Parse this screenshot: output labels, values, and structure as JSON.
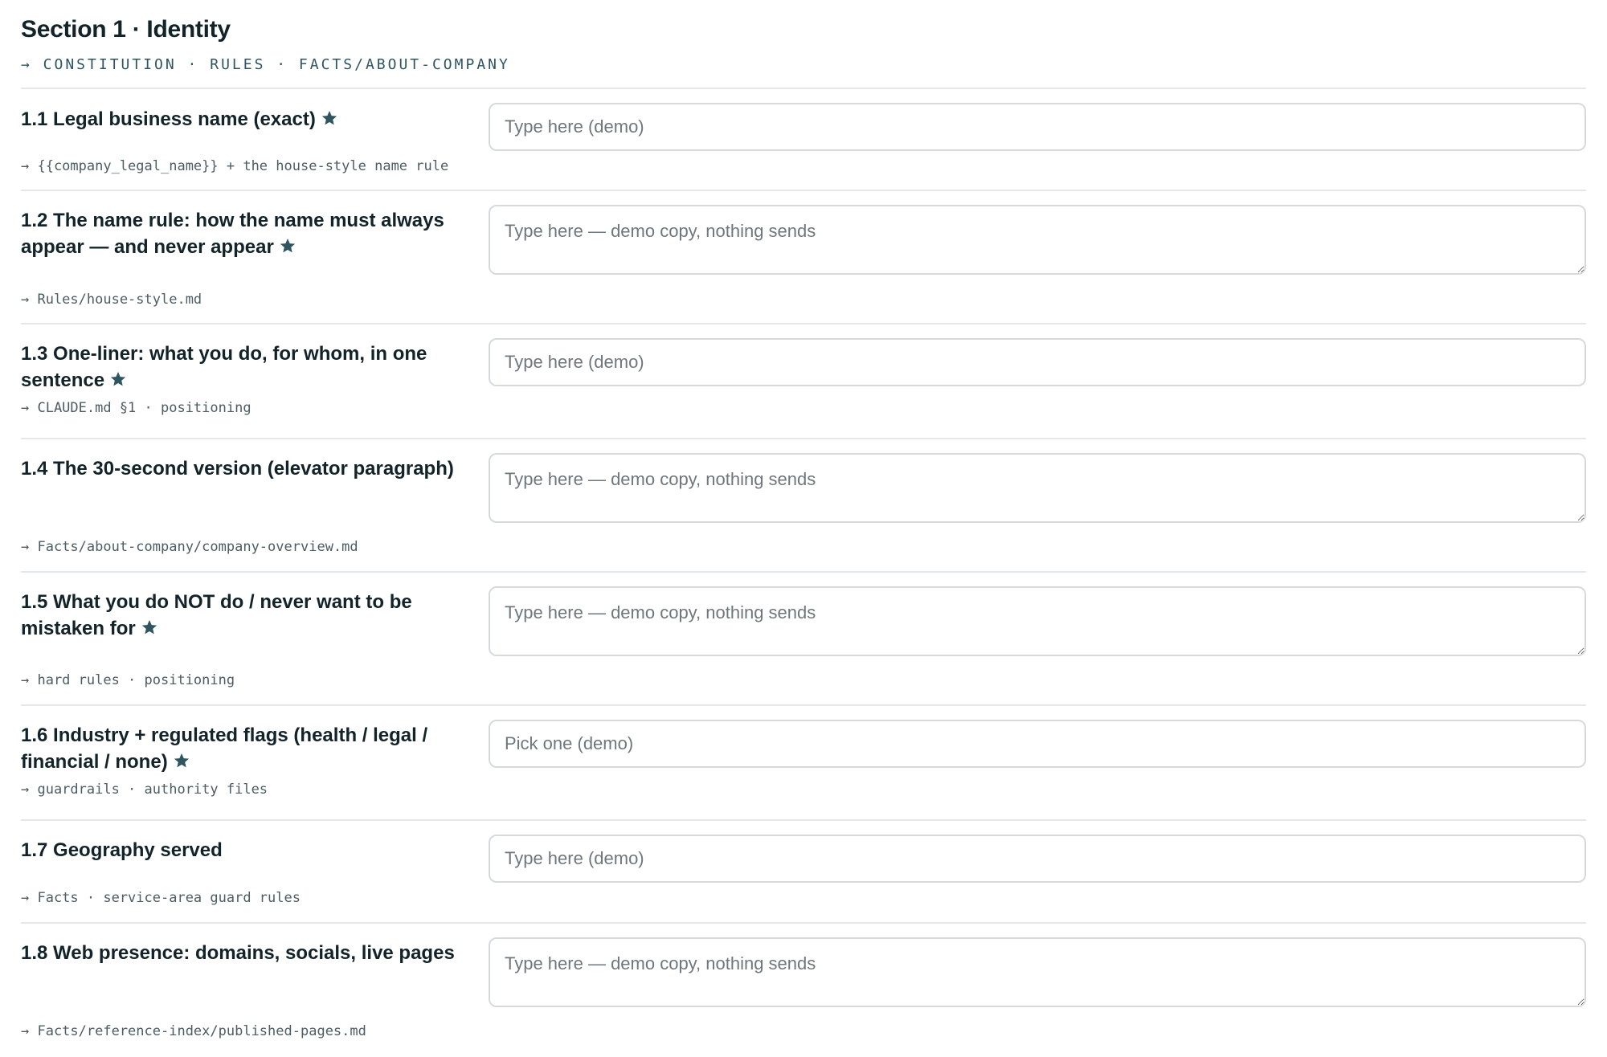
{
  "section": {
    "title": "Section 1 · Identity",
    "tags": "→ CONSTITUTION · RULES · FACTS/ABOUT-COMPANY"
  },
  "questions": [
    {
      "label": "1.1 Legal business name (exact)",
      "required": true,
      "ref": "→ {{company_legal_name}} + the house-style name rule",
      "field_type": "input",
      "placeholder": "Type here (demo)"
    },
    {
      "label": "1.2 The name rule: how the name must always appear — and never appear",
      "required": true,
      "ref": "→ Rules/house-style.md",
      "field_type": "textarea",
      "placeholder": "Type here — demo copy, nothing sends"
    },
    {
      "label": "1.3 One-liner: what you do, for whom, in one sentence",
      "required": true,
      "ref": "→ CLAUDE.md §1 · positioning",
      "field_type": "input",
      "placeholder": "Type here (demo)"
    },
    {
      "label": "1.4 The 30-second version (elevator paragraph)",
      "required": false,
      "ref": "→ Facts/about-company/company-overview.md",
      "field_type": "textarea",
      "placeholder": "Type here — demo copy, nothing sends"
    },
    {
      "label": "1.5 What you do NOT do / never want to be mistaken for",
      "required": true,
      "ref": "→ hard rules · positioning",
      "field_type": "textarea",
      "placeholder": "Type here — demo copy, nothing sends"
    },
    {
      "label": "1.6 Industry + regulated flags (health / legal / financial / none)",
      "required": true,
      "ref": "→ guardrails · authority files",
      "field_type": "select",
      "placeholder": "Pick one (demo)"
    },
    {
      "label": "1.7 Geography served",
      "required": false,
      "ref": "→ Facts · service-area guard rules",
      "field_type": "input",
      "placeholder": "Type here (demo)"
    },
    {
      "label": "1.8 Web presence: domains, socials, live pages",
      "required": false,
      "ref": "→ Facts/reference-index/published-pages.md",
      "field_type": "textarea",
      "placeholder": "Type here — demo copy, nothing sends"
    }
  ],
  "icons": {
    "required_marker": "star-icon"
  },
  "colors": {
    "text": "#13232a",
    "accent": "#2f5560",
    "border": "#d6dadd",
    "rule": "#e5e8ea",
    "placeholder": "#6e777b"
  }
}
